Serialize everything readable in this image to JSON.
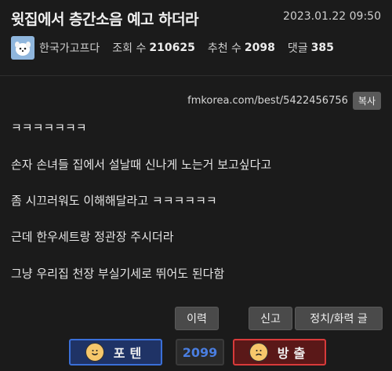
{
  "post": {
    "title": "윗집에서 층간소음 예고 하더라",
    "date": "2023.01.22 09:50",
    "author": "한국가고프다",
    "views_label": "조회 수",
    "views": "210625",
    "recommend_label": "추천 수",
    "recommend": "2098",
    "comments_label": "댓글",
    "comments": "385",
    "url": "fmkorea.com/best/5422456756",
    "copy_label": "복사",
    "lines": [
      "ㅋㅋㅋㅋㅋㅋㅋ",
      "손자 손녀들 집에서 설날때 신나게 노는거 보고싶다고",
      "좀 시끄러워도 이해해달라고 ㅋㅋㅋㅋㅋㅋ",
      "근데 한우세트랑 정관장 주시더라",
      "그냥 우리집 천장 부실기세로 뛰어도 된다함"
    ]
  },
  "actions": {
    "history": "이력",
    "report": "신고",
    "politics": "정치/화력 글"
  },
  "vote": {
    "up": "포텐",
    "count": "2099",
    "down": "방출"
  },
  "colors": {
    "up_border": "#3a6fd8",
    "down_border": "#d83a3a",
    "count_color": "#4a7ee0"
  }
}
